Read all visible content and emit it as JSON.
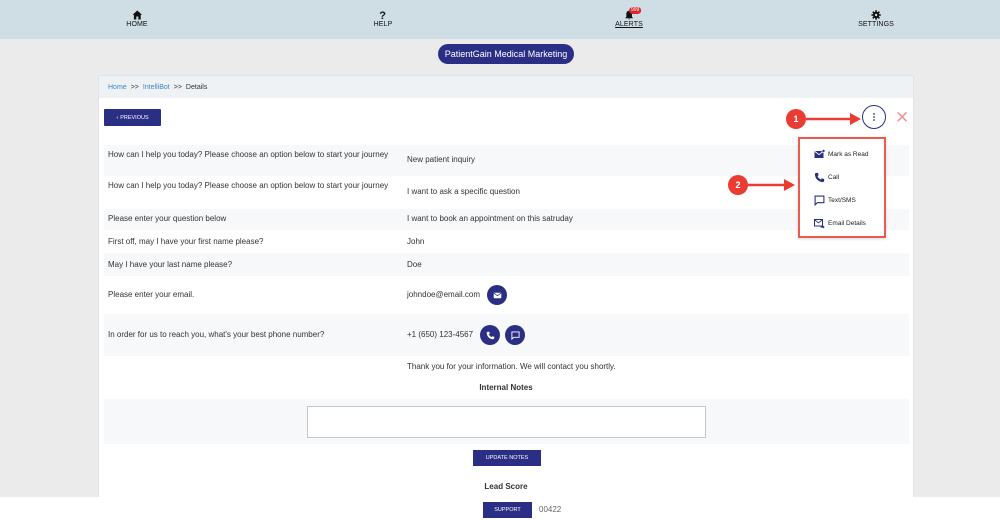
{
  "nav": {
    "home": {
      "label": "HOME",
      "icon": "home-icon"
    },
    "help": {
      "label": "HELP",
      "icon": "question-icon"
    },
    "alerts": {
      "label": "ALERTS",
      "icon": "bell-icon",
      "badge": "999"
    },
    "settings": {
      "label": "SETTINGS",
      "icon": "gear-icon"
    }
  },
  "brand": {
    "label": "PatientGain Medical Marketing"
  },
  "breadcrumb": {
    "home": "Home",
    "sep1": ">>",
    "intellibot": "IntelliBot",
    "sep2": ">>",
    "current": "Details"
  },
  "toolbar": {
    "previous_label": "PREVIOUS",
    "close_label": "✕"
  },
  "rows": [
    {
      "question": "How can I help you today? Please choose an option below to start your journey",
      "answer": "New patient inquiry"
    },
    {
      "question": "How can I help you today? Please choose an option below to start your journey",
      "answer": "I want to ask a specific question"
    },
    {
      "question": "Please enter your question below",
      "answer": "I want to book an appointment on this satruday"
    },
    {
      "question": "First off, may I have your first name please?",
      "answer": "John"
    },
    {
      "question": "May I have your last name please?",
      "answer": "Doe"
    },
    {
      "question": "Please enter your email.",
      "answer": "johndoe@email.com"
    },
    {
      "question": "In order for us to reach you, what's your best phone number?",
      "answer": "+1 (650) 123-4567"
    },
    {
      "question": "",
      "answer": "Thank you for your information. We will contact you shortly."
    }
  ],
  "notes": {
    "title": "Internal Notes",
    "value": "",
    "update_label": "UPDATE NOTES"
  },
  "lead_score": {
    "title": "Lead Score"
  },
  "menu": {
    "items": [
      {
        "label": "Mark as Read",
        "icon": "mail-read-icon"
      },
      {
        "label": "Call",
        "icon": "phone-icon"
      },
      {
        "label": "Text/SMS",
        "icon": "chat-icon"
      },
      {
        "label": "Email Details",
        "icon": "email-forward-icon"
      }
    ]
  },
  "callouts": {
    "one": "1",
    "two": "2"
  },
  "footer": {
    "support_label": "SUPPORT",
    "version": "00422"
  },
  "colors": {
    "primary": "#2a2f85",
    "accent": "#ea3c32",
    "nav_bg": "#cfdde4",
    "link": "#3a86c8"
  }
}
